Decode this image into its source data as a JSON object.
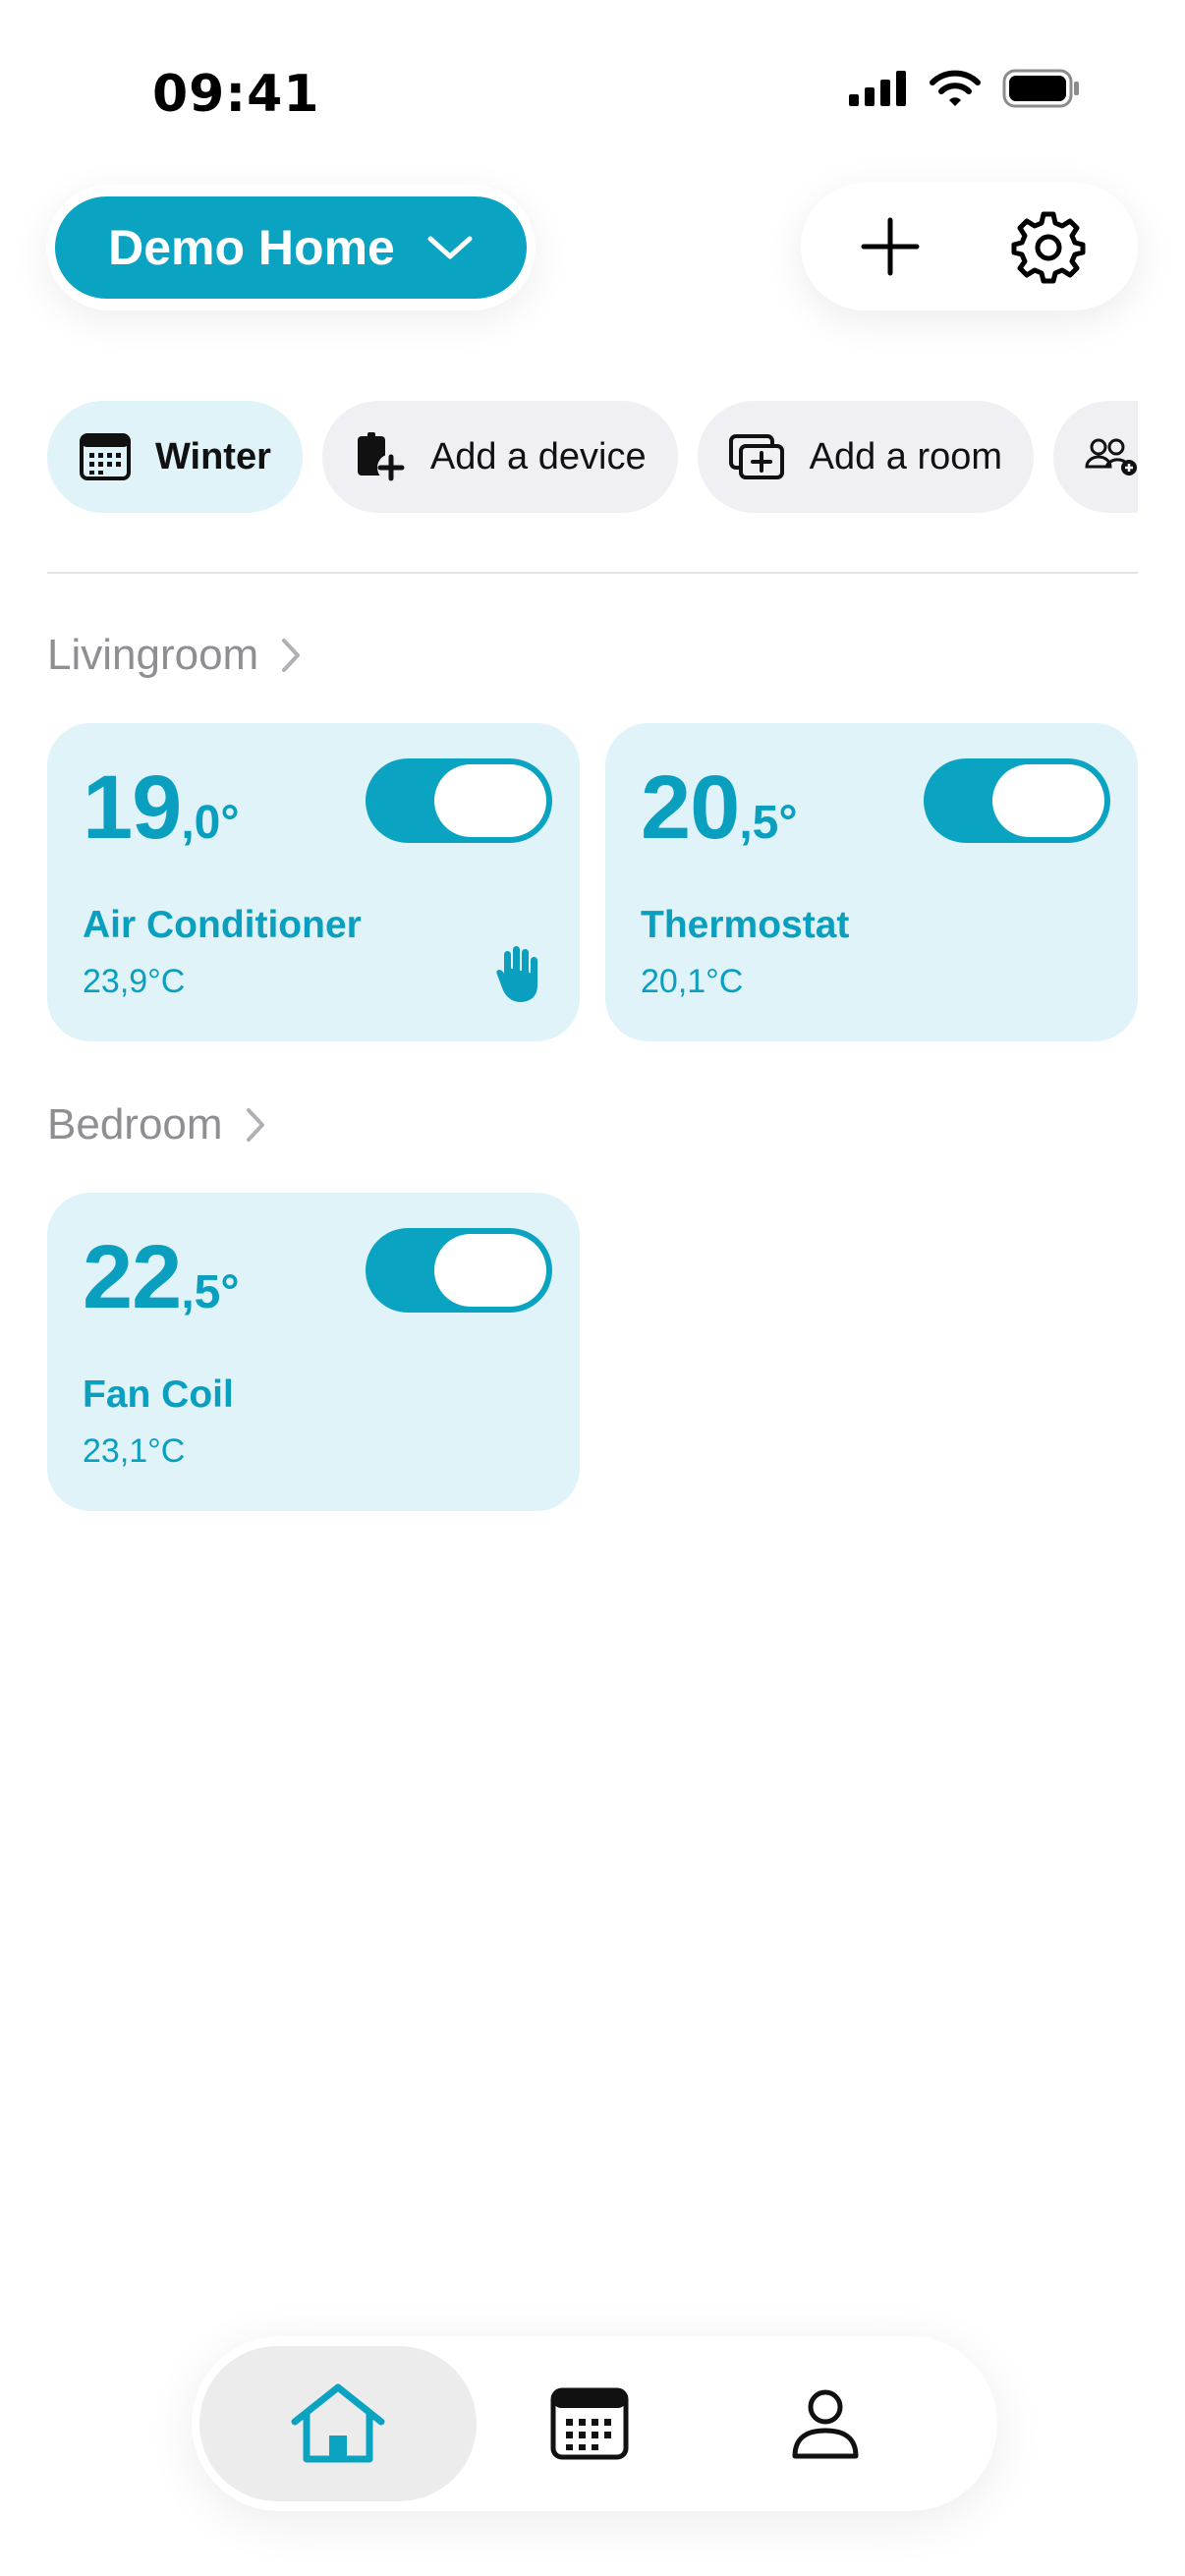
{
  "status_bar": {
    "time": "09:41"
  },
  "header": {
    "home_name": "Demo Home",
    "home_chevron": "chevron-down-icon",
    "add_icon": "plus-icon",
    "settings_icon": "gear-icon"
  },
  "chips": [
    {
      "label": "Winter",
      "icon": "calendar-icon",
      "active": true
    },
    {
      "label": "Add a device",
      "icon": "add-device-icon",
      "active": false
    },
    {
      "label": "Add a room",
      "icon": "add-room-icon",
      "active": false
    },
    {
      "label": "",
      "icon": "add-user-icon",
      "active": false
    }
  ],
  "rooms": [
    {
      "name": "Livingroom",
      "devices": [
        {
          "setpoint_int": "19",
          "setpoint_dec": ",0°",
          "name": "Air Conditioner",
          "current_temp": "23,9°C",
          "on": true,
          "manual_mode_icon": "hand-icon"
        },
        {
          "setpoint_int": "20",
          "setpoint_dec": ",5°",
          "name": "Thermostat",
          "current_temp": "20,1°C",
          "on": true
        }
      ]
    },
    {
      "name": "Bedroom",
      "devices": [
        {
          "setpoint_int": "22",
          "setpoint_dec": ",5°",
          "name": "Fan Coil",
          "current_temp": "23,1°C",
          "on": true
        }
      ]
    }
  ],
  "bottom_nav": [
    {
      "icon": "home-icon",
      "active": true
    },
    {
      "icon": "calendar-icon",
      "active": false
    },
    {
      "icon": "profile-icon",
      "active": false
    }
  ],
  "colors": {
    "accent": "#0aa3c2",
    "card_bg": "#dff3f9",
    "chip_bg": "#f0f0f4",
    "muted_text": "#8e8e93"
  }
}
